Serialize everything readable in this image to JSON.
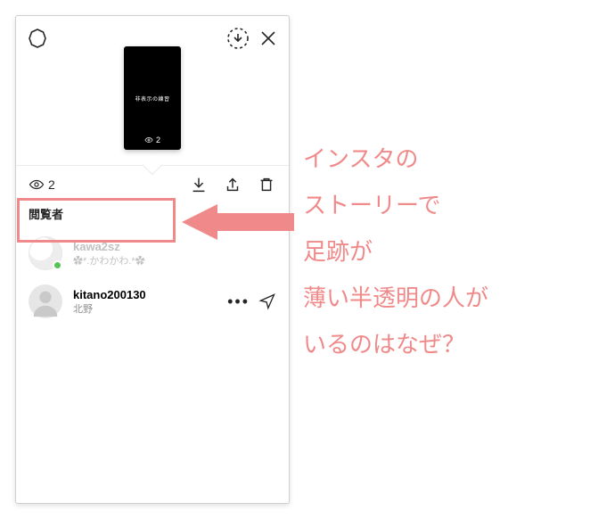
{
  "topbar": {
    "settings_icon": "settings",
    "save_icon": "save-circle",
    "close_icon": "close"
  },
  "thumb": {
    "caption": "非表示の練習",
    "views": "2"
  },
  "viewers_bar": {
    "count": "2"
  },
  "section_title": "閲覧者",
  "viewers": [
    {
      "username": "kawa2sz",
      "display_name": "✿*.かわかわ.*✿",
      "online": true,
      "faded": true
    },
    {
      "username": "kitano200130",
      "display_name": "北野",
      "online": false,
      "faded": false
    }
  ],
  "annotation": {
    "lines": [
      "インスタの",
      "ストーリーで",
      "足跡が",
      "薄い半透明の人が",
      "いるのはなぜ？"
    ]
  },
  "colors": {
    "accent": "#f08a8a",
    "text_primary": "#262626",
    "text_secondary": "#8e8e8e",
    "presence": "#56c452"
  }
}
